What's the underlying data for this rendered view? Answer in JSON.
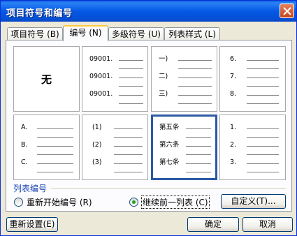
{
  "window": {
    "title": "项目符号和编号"
  },
  "tabs": [
    {
      "label": "项目符号 (B)"
    },
    {
      "label": "编号 (N)"
    },
    {
      "label": "多级符号 (U)"
    },
    {
      "label": "列表样式 (L)"
    }
  ],
  "cells": [
    {
      "none_label": "无"
    },
    {
      "rows": [
        "09001.",
        "09001.",
        "09001."
      ]
    },
    {
      "rows": [
        "一)",
        "二)",
        "三)"
      ]
    },
    {
      "rows": [
        "6.",
        "7.",
        "8."
      ]
    },
    {
      "rows": [
        "A.",
        "B.",
        "C."
      ]
    },
    {
      "rows": [
        "(1)",
        "(2)",
        "(3)"
      ]
    },
    {
      "rows": [
        "第五条",
        "第六条",
        "第七条"
      ]
    },
    {
      "rows": [
        "1.",
        "2.",
        "3."
      ]
    }
  ],
  "list_numbering": {
    "label": "列表编号",
    "restart_label": "重新开始编号 (R)",
    "continue_label": "继续前一列表 (C)",
    "selected": "continue"
  },
  "buttons": {
    "customize": "自定义(T)...",
    "reset": "重新设置(E)",
    "ok": "确定",
    "cancel": "取消"
  },
  "colors": {
    "titlebar": "#0558e3",
    "selection_border": "#2b5aa6",
    "close_button": "#c7431c"
  }
}
